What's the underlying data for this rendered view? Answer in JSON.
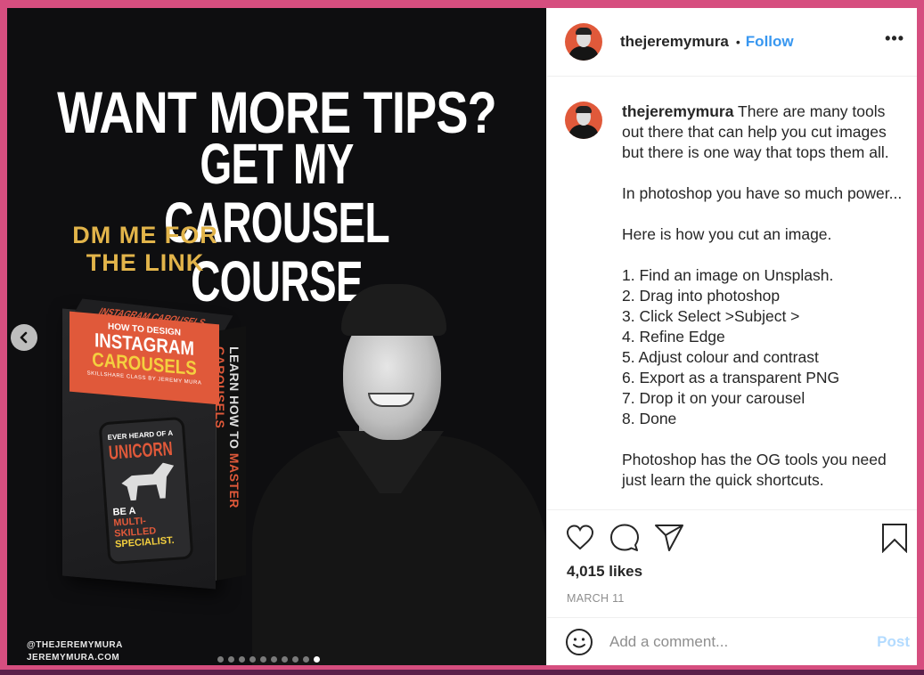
{
  "colors": {
    "frame": "#d64e7f",
    "accent": "#3897f0",
    "post_disabled": "#b3dbff",
    "text": "#262626",
    "muted": "#8e8e8e",
    "slide_orange": "#e0593a",
    "slide_gold": "#e2b44a"
  },
  "media": {
    "headline_line1": "WANT MORE TIPS?",
    "headline_line2": "GET MY CAROUSEL COURSE",
    "dm_line1": "DM ME FOR",
    "dm_line2": "THE LINK",
    "product": {
      "top_text": "INSTAGRAM CAROUSELS",
      "how_to": "HOW TO DESIGN",
      "title_1": "INSTAGRAM",
      "title_2": "CAROUSELS",
      "byline": "SKILLSHARE CLASS BY JEREMY MURA",
      "side_white": "LEARN HOW TO ",
      "side_orange": "MASTER CAROUSELS",
      "phone_line1": "EVER HEARD OF A",
      "phone_line2": "UNICORN",
      "phone_line3": "BE A",
      "phone_line4": "MULTI-SKILLED",
      "phone_line5": "SPECIALIST."
    },
    "handle": "@THEJEREMYMURA",
    "website": "JEREMYMURA.COM",
    "prev_icon": "chevron-left-icon",
    "carousel": {
      "total": 10,
      "active_index": 10
    }
  },
  "header": {
    "username": "thejeremymura",
    "separator": "•",
    "follow_label": "Follow",
    "more_label": "•••"
  },
  "caption": {
    "username": "thejeremymura",
    "text": " There are many tools out there that can help you cut images but there is one way that tops them all.\n\nIn photoshop you have so much power...\n\nHere is how you cut an image.\n\n1. Find an image on Unsplash.\n2. Drag into photoshop\n3. Click Select >Subject >\n4. Refine Edge\n5. Adjust colour and contrast\n6. Export as a transparent PNG\n7. Drop it on your carousel\n8. Done\n\nPhotoshop has the OG tools you need just learn the quick shortcuts."
  },
  "actions": {
    "icons": [
      "heart-icon",
      "comment-icon",
      "share-icon",
      "bookmark-icon"
    ],
    "likes": "4,015 likes",
    "date": "MARCH 11"
  },
  "comment": {
    "placeholder": "Add a comment...",
    "value": "",
    "post_label": "Post"
  }
}
